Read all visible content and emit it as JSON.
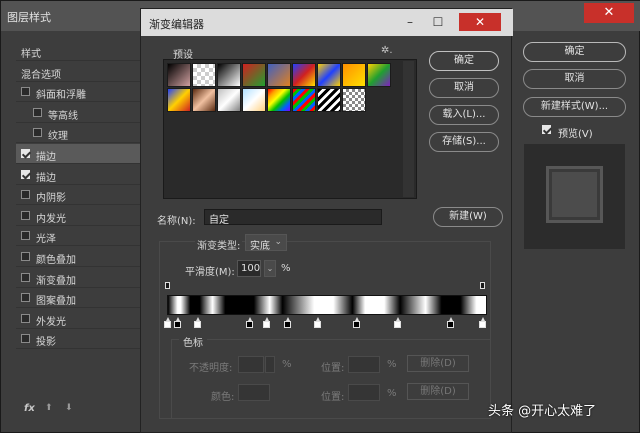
{
  "layer_style": {
    "title": "图层样式",
    "close_glyph": "✕",
    "list": [
      {
        "label": "样式",
        "type": "header"
      },
      {
        "label": "混合选项",
        "type": "header"
      },
      {
        "label": "斜面和浮雕",
        "type": "check",
        "checked": false,
        "indent": 0
      },
      {
        "label": "等高线",
        "type": "check",
        "checked": false,
        "indent": 1
      },
      {
        "label": "纹理",
        "type": "check",
        "checked": false,
        "indent": 1
      },
      {
        "label": "描边",
        "type": "check",
        "checked": true,
        "indent": 0,
        "selected": true
      },
      {
        "label": "描边",
        "type": "check",
        "checked": true,
        "indent": 0
      },
      {
        "label": "内阴影",
        "type": "check",
        "checked": false,
        "indent": 0
      },
      {
        "label": "内发光",
        "type": "check",
        "checked": false,
        "indent": 0
      },
      {
        "label": "光泽",
        "type": "check",
        "checked": false,
        "indent": 0
      },
      {
        "label": "颜色叠加",
        "type": "check",
        "checked": false,
        "indent": 0
      },
      {
        "label": "渐变叠加",
        "type": "check",
        "checked": false,
        "indent": 0
      },
      {
        "label": "图案叠加",
        "type": "check",
        "checked": false,
        "indent": 0
      },
      {
        "label": "外发光",
        "type": "check",
        "checked": false,
        "indent": 0
      },
      {
        "label": "投影",
        "type": "check",
        "checked": false,
        "indent": 0
      }
    ],
    "fx_label": "fx",
    "up_glyph": "⬆",
    "down_glyph": "⬇",
    "buttons": {
      "ok": "确定",
      "cancel": "取消",
      "new_style": "新建样式(W)...",
      "preview_label": "预览(V)"
    },
    "preview_checked": true
  },
  "gradient_editor": {
    "title": "渐变编辑器",
    "minimize_glyph": "–",
    "maximize_glyph": "☐",
    "close_glyph": "✕",
    "presets_label": "预设",
    "gear_glyph": "✲.",
    "presets": [
      "linear-gradient(135deg,#000 0%,#d0a0a0 100%)",
      "repeating-conic-gradient(#ccc 0 25%,#fff 0 50%) 0 0/8px 8px",
      "linear-gradient(135deg,#000 0%,#fff 100%)",
      "linear-gradient(135deg,#d02020 0%,#20a030 100%)",
      "linear-gradient(135deg,#4060c0 0%,#e08020 100%)",
      "linear-gradient(135deg,#2040ff 0%,#d02020 50%,#ffe000 100%)",
      "linear-gradient(135deg,#ffd000 0%,#2040ff 50%,#ffd000 100%)",
      "linear-gradient(135deg,#ff9000 0%,#ffe000 100%)",
      "linear-gradient(135deg,#ffd000 0%,#20a030 50%,#8020c0 100%)",
      "linear-gradient(135deg,#2040ff 0%,#ffd000 50%,#d02020 100%)",
      "linear-gradient(135deg,#5a2a10 0%,#f0c0a0 50%,#5a2a10 100%)",
      "linear-gradient(135deg,#c0c0c0 0%,#fff 50%,#808080 100%)",
      "linear-gradient(135deg,#b0e0ff 0%,#fff 50%,#ffd080 100%)",
      "linear-gradient(135deg,#ff0000,#ffa000,#ffff00,#00c000,#0060ff,#8000ff)",
      "repeating-linear-gradient(135deg,#ff0000 0 3px,#00c000 3px 6px,#0060ff 6px 9px)",
      "repeating-linear-gradient(135deg,#000 0 3px,#fff 3px 6px)",
      "repeating-conic-gradient(#888 0 25%,#fff 0 50%) 0 0/6px 6px"
    ],
    "buttons": {
      "ok": "确定",
      "cancel": "取消",
      "load": "载入(L)...",
      "save": "存储(S)...",
      "new": "新建(W)"
    },
    "name_label": "名称(N):",
    "name_value": "自定",
    "type_label": "渐变类型:",
    "type_value": "实底",
    "smooth_label": "平滑度(M):",
    "smooth_value": "100",
    "smooth_unit": "%",
    "gradient": "linear-gradient(90deg,#000 0%,#fff 3%,#fff 4%,#000 7%,#000 10%,#fff 14%,#000 18%,#000 27%,#fff 32%,#000 36%,#fff 46%,#fff 52%,#000 58%,#fff 62%,#fff 68%,#000 73%,#fff 81%,#000 86%,#000 89%,#000 92%,#fff 97%,#fff 100%)",
    "color_stops": [
      {
        "pos": 0.0,
        "color": "#fff"
      },
      {
        "pos": 0.03,
        "color": "#000"
      },
      {
        "pos": 0.095,
        "color": "#fff"
      },
      {
        "pos": 0.255,
        "color": "#000"
      },
      {
        "pos": 0.31,
        "color": "#fff"
      },
      {
        "pos": 0.375,
        "color": "#000"
      },
      {
        "pos": 0.47,
        "color": "#fff"
      },
      {
        "pos": 0.59,
        "color": "#000"
      },
      {
        "pos": 0.72,
        "color": "#fff"
      },
      {
        "pos": 0.885,
        "color": "#000"
      },
      {
        "pos": 0.985,
        "color": "#fff"
      }
    ],
    "opacity_stops": [
      0.0,
      0.985
    ],
    "stops_title": "色标",
    "opacity_label": "不透明度:",
    "percent": "%",
    "location_label": "位置:",
    "delete_label": "删除(D)",
    "color_label": "颜色:"
  },
  "watermark": "头条 @开心太难了"
}
